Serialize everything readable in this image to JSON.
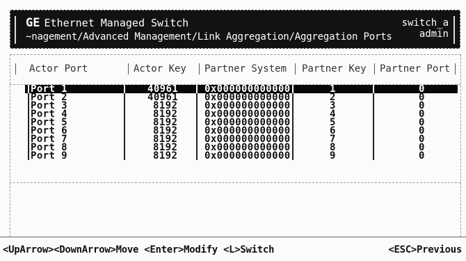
{
  "header": {
    "brand": "GE",
    "title": "Ethernet Managed Switch",
    "breadcrumb": "~nagement/Advanced Management/Link Aggregation/Aggregation Ports",
    "host": "switch_a",
    "user": "admin"
  },
  "table": {
    "columns": [
      "Actor Port",
      "Actor Key",
      "Partner System",
      "Partner Key",
      "Partner Port"
    ],
    "rows": [
      {
        "port": "Port  1",
        "actor_key": "40961",
        "partner_system": "0x000000000000",
        "partner_key": "1",
        "partner_port": "0"
      },
      {
        "port": "Port  2",
        "actor_key": "40961",
        "partner_system": "0x000000000000",
        "partner_key": "2",
        "partner_port": "0"
      },
      {
        "port": "Port  3",
        "actor_key": "8192",
        "partner_system": "0x000000000000",
        "partner_key": "3",
        "partner_port": "0"
      },
      {
        "port": "Port  4",
        "actor_key": "8192",
        "partner_system": "0x000000000000",
        "partner_key": "4",
        "partner_port": "0"
      },
      {
        "port": "Port  5",
        "actor_key": "8192",
        "partner_system": "0x000000000000",
        "partner_key": "5",
        "partner_port": "0"
      },
      {
        "port": "Port  6",
        "actor_key": "8192",
        "partner_system": "0x000000000000",
        "partner_key": "6",
        "partner_port": "0"
      },
      {
        "port": "Port  7",
        "actor_key": "8192",
        "partner_system": "0x000000000000",
        "partner_key": "7",
        "partner_port": "0"
      },
      {
        "port": "Port  8",
        "actor_key": "8192",
        "partner_system": "0x000000000000",
        "partner_key": "8",
        "partner_port": "0"
      },
      {
        "port": "Port  9",
        "actor_key": "8192",
        "partner_system": "0x000000000000",
        "partner_key": "9",
        "partner_port": "0"
      }
    ]
  },
  "footer": {
    "hint": "<UpArrow><DownArrow>Move <Enter>Modify <L>Switch",
    "escape": "<ESC>Previous"
  }
}
